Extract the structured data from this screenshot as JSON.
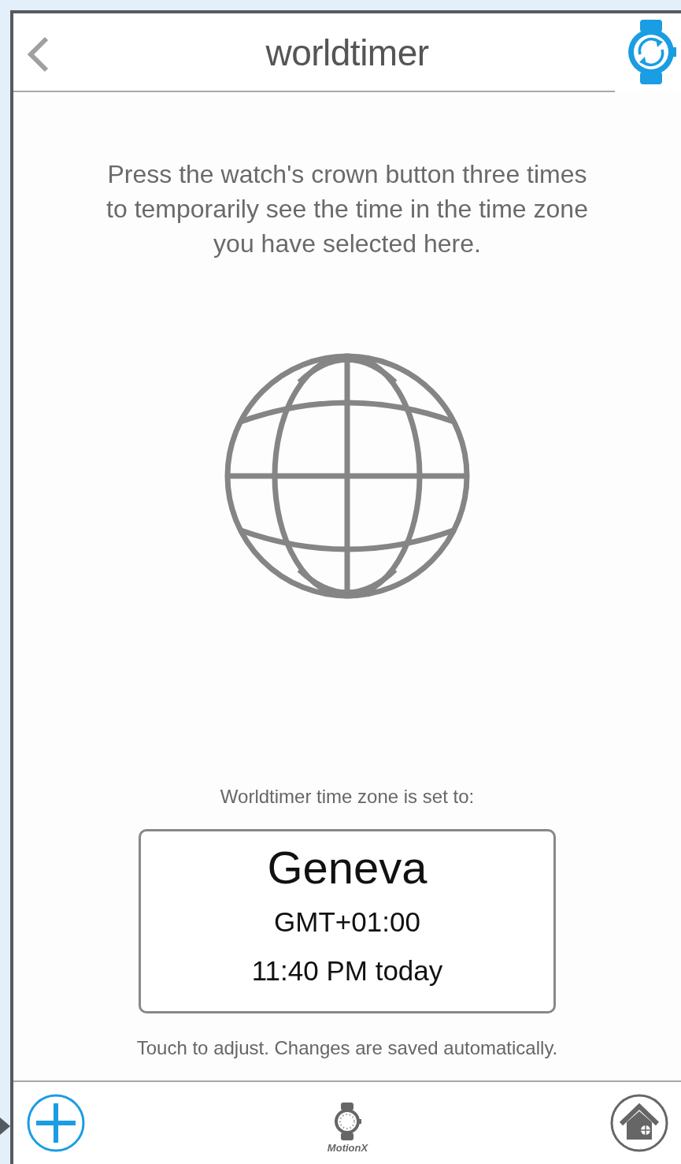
{
  "header": {
    "title": "worldtimer"
  },
  "instructions": "Press the watch's crown button three times to temporarily see the time in the time zone you have selected here.",
  "zone_label": "Worldtimer time zone is set to:",
  "zone": {
    "city": "Geneva",
    "offset": "GMT+01:00",
    "time": "11:40 PM today"
  },
  "hint": "Touch to adjust. Changes are saved automatically.",
  "toolbar": {
    "brand": "MotionX"
  }
}
